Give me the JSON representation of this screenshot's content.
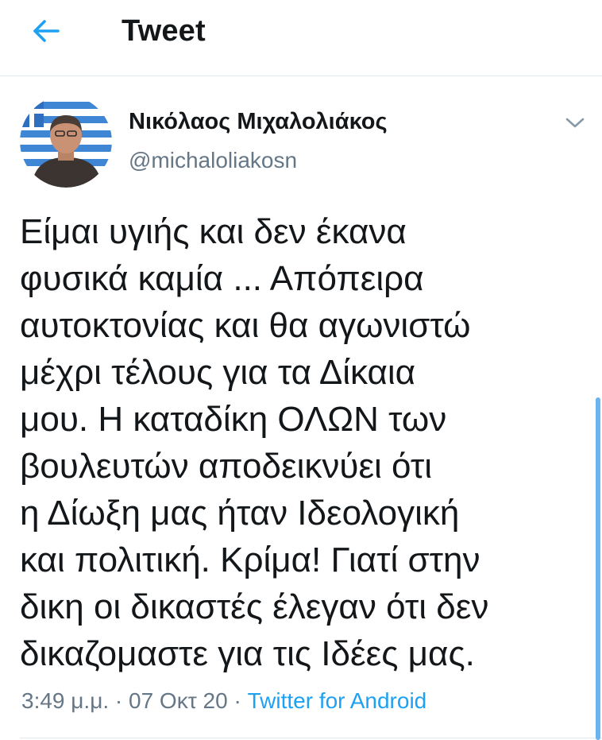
{
  "header": {
    "title": "Tweet",
    "back_icon": "arrow-left-icon"
  },
  "tweet": {
    "author_name": "Νικόλαος Μιχαλολιάκος",
    "author_handle": "@michaloliakosn",
    "more_icon": "chevron-down-icon",
    "text_lines": [
      "Είμαι υγιής και δεν έκανα",
      "φυσικά καμία ... Απόπειρα",
      "αυτοκτονίας και θα αγωνιστώ",
      "μέχρι τέλους για τα Δίκαια",
      "μου. Η καταδίκη ΟΛΩΝ των",
      "βουλευτών αποδεικνύει ότι",
      "η Δίωξη μας ήταν Ιδεολογική",
      "και πολιτική. Κρίμα! Γιατί στην",
      "δικη οι δικαστές έλεγαν ότι δεν",
      "δικαζομαστε για τις Ιδέες μας."
    ],
    "time": "3:49 μ.μ.",
    "separator": "·",
    "date": "07 Οκτ 20",
    "source": "Twitter for Android"
  },
  "colors": {
    "accent": "#1da1f2",
    "secondary_text": "#657786",
    "divider": "#e1e8ed"
  }
}
